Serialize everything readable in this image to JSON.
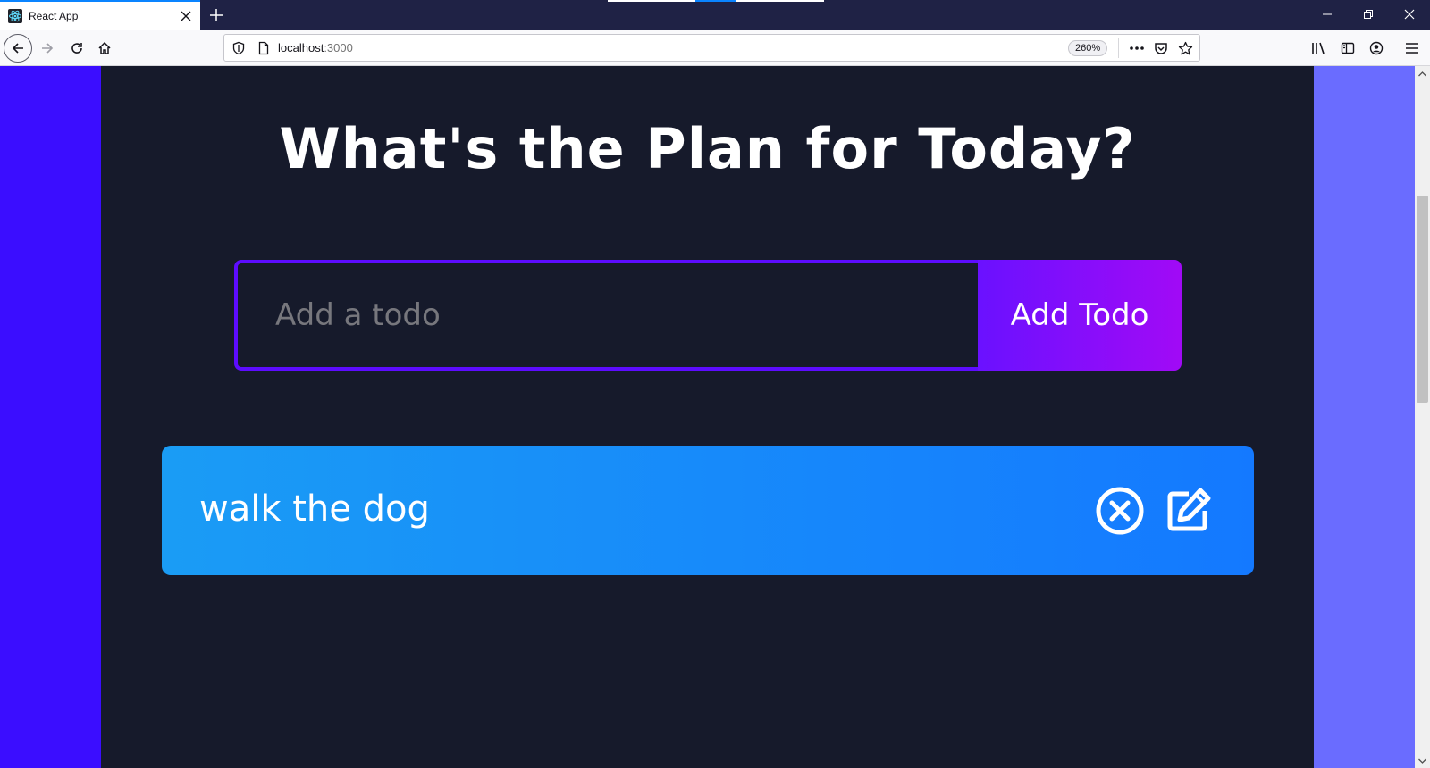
{
  "browser": {
    "tab": {
      "title": "React App",
      "favicon": "react-logo-icon",
      "close_icon": "close-icon"
    },
    "new_tab_icon": "plus-icon",
    "window_controls": [
      "minimize-icon",
      "restore-icon",
      "close-icon"
    ],
    "nav": {
      "back_icon": "arrow-left-icon",
      "forward_icon": "arrow-right-icon",
      "reload_icon": "reload-icon",
      "home_icon": "home-icon"
    },
    "url": {
      "host": "localhost",
      "port": ":3000"
    },
    "zoom": "260%",
    "url_actions": [
      "more-icon",
      "pocket-icon",
      "bookmark-star-icon"
    ],
    "toolbar": [
      "library-icon",
      "sidebar-icon",
      "account-icon",
      "menu-icon"
    ]
  },
  "app": {
    "heading": "What's the Plan for Today?",
    "form": {
      "input_placeholder": "Add a todo",
      "input_value": "",
      "button_label": "Add Todo"
    },
    "todos": [
      {
        "text": "walk the dog",
        "delete_icon": "close-circle-icon",
        "edit_icon": "edit-icon"
      }
    ]
  },
  "colors": {
    "page_left": "#3b0dff",
    "page_right": "#6a6cff",
    "app_bg": "#161a2b",
    "input_border": "#5d0cff",
    "button_gradient": [
      "#6a11ff",
      "#a10af6"
    ],
    "todo_gradient": [
      "#1a9cf5",
      "#1479ff"
    ]
  }
}
